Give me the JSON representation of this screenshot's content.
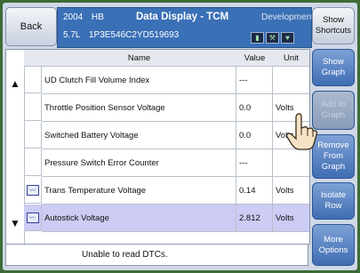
{
  "header": {
    "back_label": "Back",
    "year": "2004",
    "model": "HB",
    "title": "Data Display - TCM",
    "mode": "Development",
    "engine": "5.7L",
    "vin": "1P3E546C2YD519693",
    "icons": [
      "battery-icon",
      "tools-icon",
      "heart-icon"
    ]
  },
  "table": {
    "columns": [
      "Name",
      "Value",
      "Unit"
    ],
    "rows": [
      {
        "name": "UD Clutch Fill Volume Index",
        "value": "---",
        "unit": "",
        "graph": false,
        "selected": false
      },
      {
        "name": "Throttle Position Sensor Voltage",
        "value": "0.0",
        "unit": "Volts",
        "graph": false,
        "selected": false
      },
      {
        "name": "Switched Battery Voltage",
        "value": "0.0",
        "unit": "Volts",
        "graph": false,
        "selected": false
      },
      {
        "name": "Pressure Switch Error Counter",
        "value": "---",
        "unit": "",
        "graph": false,
        "selected": false
      },
      {
        "name": "Trans Temperature Voltage",
        "value": "0.14",
        "unit": "Volts",
        "graph": true,
        "selected": false
      },
      {
        "name": "Autostick Voltage",
        "value": "2.812",
        "unit": "Volts",
        "graph": true,
        "selected": true
      }
    ]
  },
  "status": "Unable to read DTCs.",
  "side_buttons": {
    "show_shortcuts": "Show Shortcuts",
    "show_graph": "Show Graph",
    "add_to_graph": "Add to Graph",
    "remove_from_graph": "Remove From Graph",
    "isolate_row": "Isolate Row",
    "more_options": "More Options"
  },
  "colors": {
    "frame": "#3d6b35",
    "header": "#3a70b6",
    "button": "#4a78bd",
    "selected_row": "#ccccf4"
  }
}
